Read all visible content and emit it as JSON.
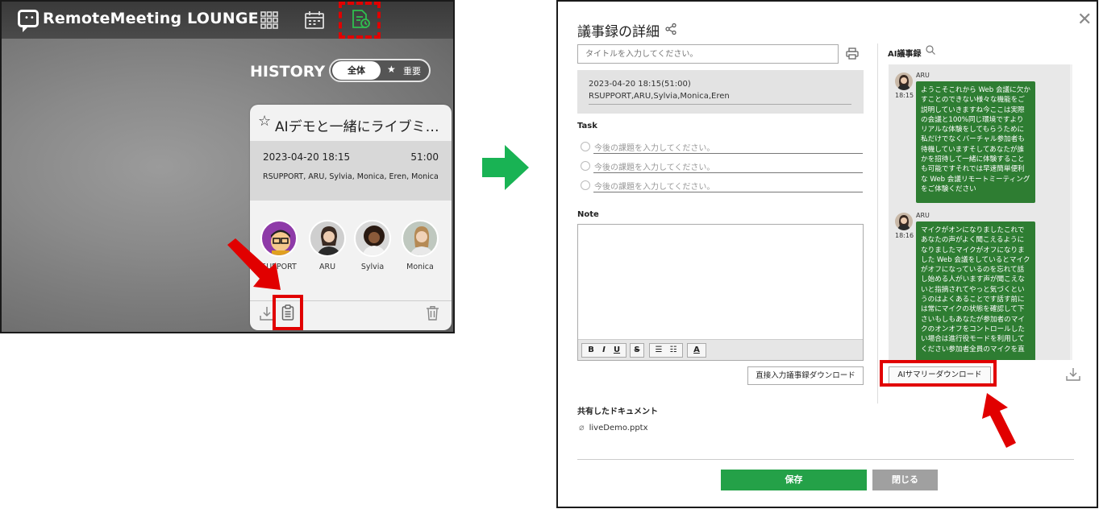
{
  "lounge": {
    "brand": "RemoteMeeting LOUNGE",
    "history_title": "HISTORY",
    "filter_all": "全体",
    "filter_important": "重要",
    "card": {
      "title": "AIデモと一緒にライブミ…",
      "date": "2023-04-20 18:15",
      "duration": "51:00",
      "members": "RSUPPORT, ARU, Sylvia, Monica, Eren, Monica",
      "participants": [
        {
          "name": "SUPPORT",
          "icon": "character-avatar"
        },
        {
          "name": "ARU",
          "icon": "person-avatar"
        },
        {
          "name": "Sylvia",
          "icon": "person-avatar"
        },
        {
          "name": "Monica",
          "icon": "person-avatar"
        }
      ]
    }
  },
  "dialog": {
    "title": "議事録の詳細",
    "title_placeholder": "タイトルを入力してください。",
    "meeting_date": "2023-04-20 18:15(51:00)",
    "meeting_members": "RSUPPORT,ARU,Sylvia,Monica,Eren",
    "task_heading": "Task",
    "task_placeholder_1": "今後の課題を入力してください。",
    "task_placeholder_2": "今後の課題を入力してください。",
    "task_placeholder_3": "今後の課題を入力してください。",
    "note_heading": "Note",
    "toolbar": {
      "bold": "B",
      "italic": "I",
      "underline": "U",
      "strike": "S",
      "color": "A"
    },
    "direct_download": "直接入力議事録ダウンロード",
    "shared_heading": "共有したドキュメント",
    "shared_file": "liveDemo.pptx",
    "save": "保存",
    "close": "閉じる",
    "ai_heading": "AI議事録",
    "ai_summary_download": "AIサマリーダウンロード",
    "messages": [
      {
        "speaker": "ARU",
        "time": "18:15",
        "text": "ようこそこれから Web 会議に欠かすことのできない様々な機能をご説明していきますね今ここは実際の会議と100%同じ環境ですよりリアルな体験をしてもらうために私だけでなくバーチャル参加者も待機していますそしてあなたが誰かを招待して一緒に体験することも可能ですそれでは早速簡単便利な Web 会議リモートミーティングをご体験ください"
      },
      {
        "speaker": "ARU",
        "time": "18:16",
        "text": "マイクがオンになりましたこれであなたの声がよく聞こえるようになりましたマイクがオフになりました Web 会議をしているとマイクがオフになっているのを忘れて話し始める人がいます声が聞こえないと指摘されてやっと気づくというのはよくあることです話す前には常にマイクの状態を確認して下さいもしもあなたが参加者のマイクのオンオフをコントロールしたい場合は進行役モードを利用してください参加者全員のマイクを直"
      }
    ]
  },
  "colors": {
    "accent_green": "#24a148",
    "bubble_green": "#2e7d32",
    "highlight_red": "#e10000"
  }
}
